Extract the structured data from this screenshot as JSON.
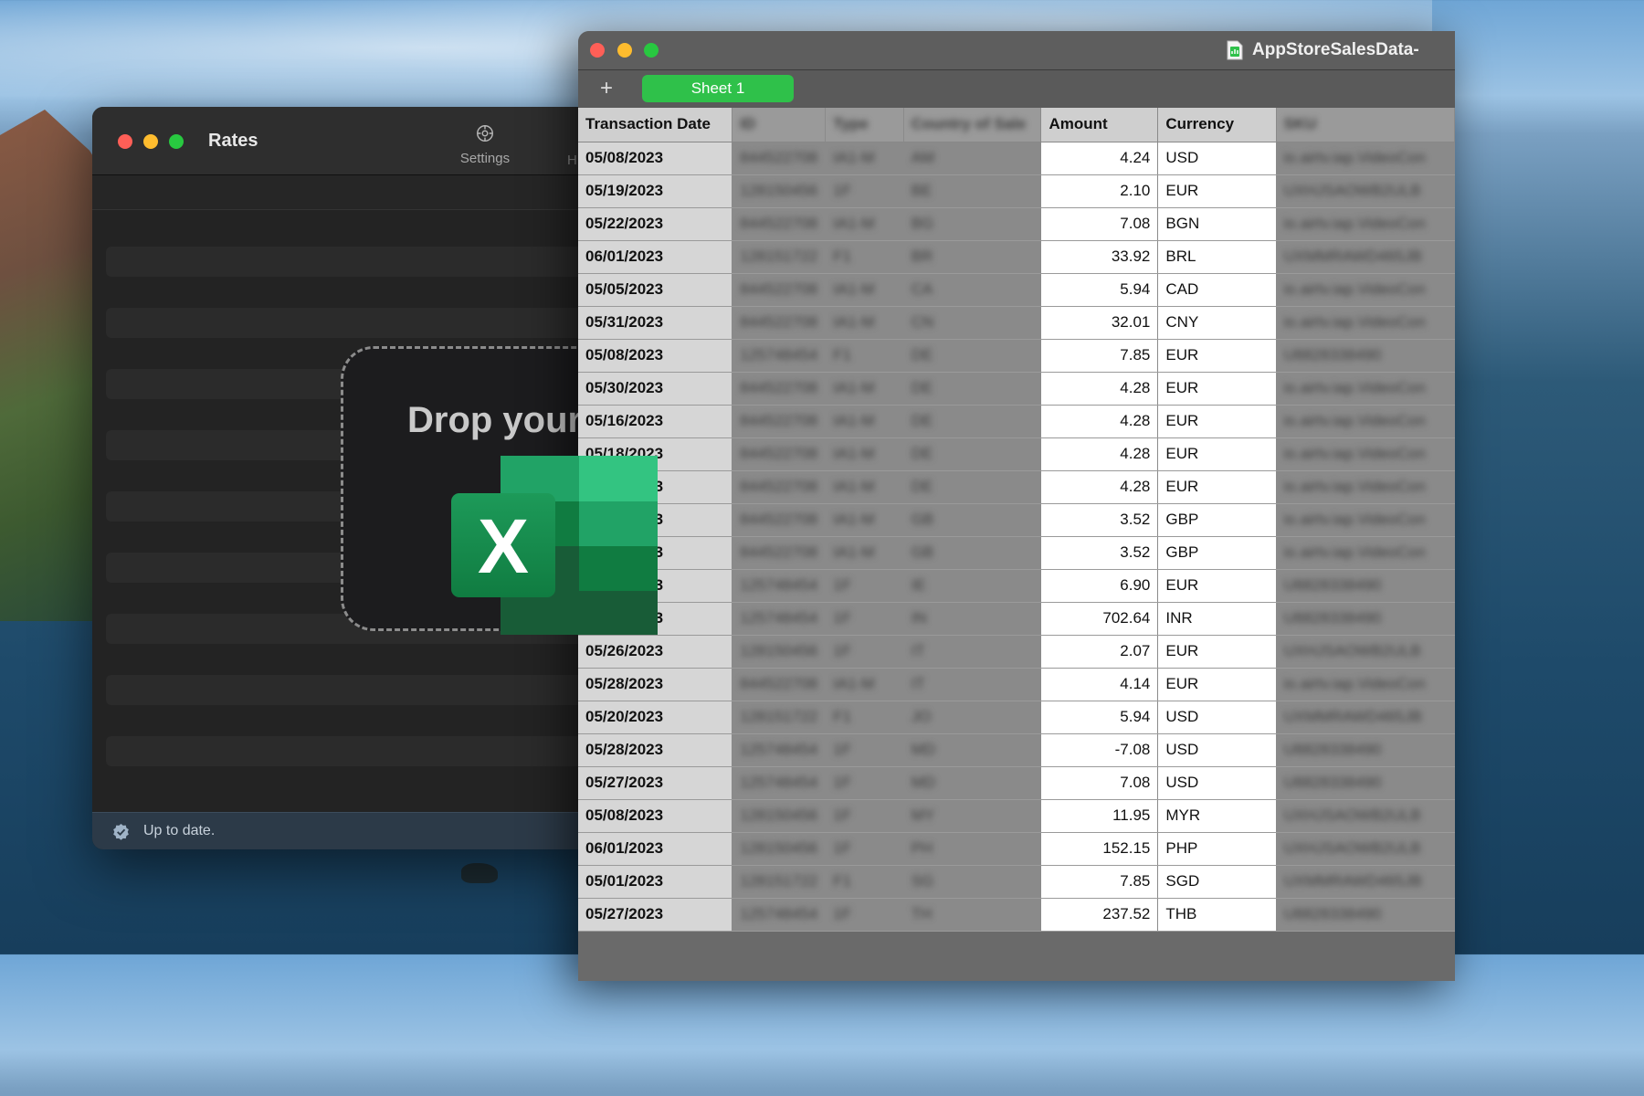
{
  "rates_window": {
    "title": "Rates",
    "settings_label": "Settings",
    "toolbar_partial": "H",
    "drop_text": "Drop your",
    "status": "Up to date."
  },
  "numbers_window": {
    "title": "AppStoreSalesData-",
    "add_sheet": "+",
    "sheet_tab": "Sheet 1",
    "columns": [
      "Transaction Date",
      "ID",
      "Type",
      "Country of Sale",
      "Amount",
      "Currency",
      "SKU"
    ],
    "rows": [
      {
        "date": "05/08/2023",
        "id": "844522708",
        "type": "IA1-M",
        "country": "AM",
        "amount": "4.24",
        "currency": "USD",
        "sku": "io.airtv.iap.VideoCon"
      },
      {
        "date": "05/19/2023",
        "id": "128150456",
        "type": "1F",
        "country": "BE",
        "amount": "2.10",
        "currency": "EUR",
        "sku": "UXHJSAOWB2ULB"
      },
      {
        "date": "05/22/2023",
        "id": "844522708",
        "type": "IA1-M",
        "country": "BG",
        "amount": "7.08",
        "currency": "BGN",
        "sku": "io.airtv.iap.VideoCon"
      },
      {
        "date": "06/01/2023",
        "id": "128151722",
        "type": "F1",
        "country": "BR",
        "amount": "33.92",
        "currency": "BRL",
        "sku": "UXMMRAWD465JB"
      },
      {
        "date": "05/05/2023",
        "id": "844522708",
        "type": "IA1-M",
        "country": "CA",
        "amount": "5.94",
        "currency": "CAD",
        "sku": "io.airtv.iap.VideoCon"
      },
      {
        "date": "05/31/2023",
        "id": "844522708",
        "type": "IA1-M",
        "country": "CN",
        "amount": "32.01",
        "currency": "CNY",
        "sku": "io.airtv.iap.VideoCon"
      },
      {
        "date": "05/08/2023",
        "id": "125748454",
        "type": "F1",
        "country": "DE",
        "amount": "7.85",
        "currency": "EUR",
        "sku": "U8828338490"
      },
      {
        "date": "05/30/2023",
        "id": "844522708",
        "type": "IA1-M",
        "country": "DE",
        "amount": "4.28",
        "currency": "EUR",
        "sku": "io.airtv.iap.VideoCon"
      },
      {
        "date": "05/16/2023",
        "id": "844522708",
        "type": "IA1-M",
        "country": "DE",
        "amount": "4.28",
        "currency": "EUR",
        "sku": "io.airtv.iap.VideoCon"
      },
      {
        "date": "05/18/2023",
        "id": "844522708",
        "type": "IA1-M",
        "country": "DE",
        "amount": "4.28",
        "currency": "EUR",
        "sku": "io.airtv.iap.VideoCon"
      },
      {
        "date": "05/20/2023",
        "id": "844522708",
        "type": "IA1-M",
        "country": "DE",
        "amount": "4.28",
        "currency": "EUR",
        "sku": "io.airtv.iap.VideoCon"
      },
      {
        "date": "05/21/2023",
        "id": "844522708",
        "type": "IA1-M",
        "country": "GB",
        "amount": "3.52",
        "currency": "GBP",
        "sku": "io.airtv.iap.VideoCon"
      },
      {
        "date": "05/25/2023",
        "id": "844522708",
        "type": "IA1-M",
        "country": "GB",
        "amount": "3.52",
        "currency": "GBP",
        "sku": "io.airtv.iap.VideoCon"
      },
      {
        "date": "05/27/2023",
        "id": "125748454",
        "type": "1F",
        "country": "IE",
        "amount": "6.90",
        "currency": "EUR",
        "sku": "U8828338490"
      },
      {
        "date": "05/30/2023",
        "id": "125748454",
        "type": "1F",
        "country": "IN",
        "amount": "702.64",
        "currency": "INR",
        "sku": "U8828338490"
      },
      {
        "date": "05/26/2023",
        "id": "128150456",
        "type": "1F",
        "country": "IT",
        "amount": "2.07",
        "currency": "EUR",
        "sku": "UXHJSAOWB2ULB"
      },
      {
        "date": "05/28/2023",
        "id": "844522708",
        "type": "IA1-M",
        "country": "IT",
        "amount": "4.14",
        "currency": "EUR",
        "sku": "io.airtv.iap.VideoCon"
      },
      {
        "date": "05/20/2023",
        "id": "128151722",
        "type": "F1",
        "country": "JO",
        "amount": "5.94",
        "currency": "USD",
        "sku": "UXMMRAWD465JB"
      },
      {
        "date": "05/28/2023",
        "id": "125748454",
        "type": "1F",
        "country": "MD",
        "amount": "-7.08",
        "currency": "USD",
        "sku": "U8828338490"
      },
      {
        "date": "05/27/2023",
        "id": "125748454",
        "type": "1F",
        "country": "MD",
        "amount": "7.08",
        "currency": "USD",
        "sku": "U8828338490"
      },
      {
        "date": "05/08/2023",
        "id": "128150456",
        "type": "1F",
        "country": "MY",
        "amount": "11.95",
        "currency": "MYR",
        "sku": "UXHJSAOWB2ULB"
      },
      {
        "date": "06/01/2023",
        "id": "128150456",
        "type": "1F",
        "country": "PH",
        "amount": "152.15",
        "currency": "PHP",
        "sku": "UXHJSAOWB2ULB"
      },
      {
        "date": "05/01/2023",
        "id": "128151722",
        "type": "F1",
        "country": "SG",
        "amount": "7.85",
        "currency": "SGD",
        "sku": "UXMMRAWD465JB"
      },
      {
        "date": "05/27/2023",
        "id": "125748454",
        "type": "1F",
        "country": "TH",
        "amount": "237.52",
        "currency": "THB",
        "sku": "U8828338490"
      }
    ]
  },
  "excel_logo": {
    "letter": "X"
  },
  "colors": {
    "sheet_tab": "#2fc14a",
    "close": "#fe5f57",
    "minimize": "#febc2e",
    "zoom": "#28c840",
    "excel_dark": "#107c41",
    "excel_light": "#33c481"
  }
}
